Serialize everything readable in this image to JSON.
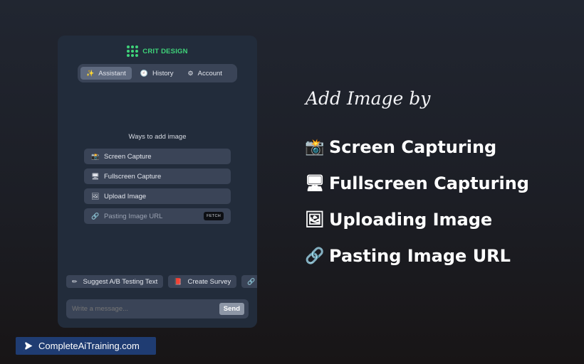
{
  "brand": {
    "name": "CRIT DESIGN",
    "color": "#3fd47a"
  },
  "tabs": [
    {
      "icon": "sparkles-icon",
      "glyph": "✨",
      "label": "Assistant",
      "active": true
    },
    {
      "icon": "clock-icon",
      "glyph": "🕘",
      "label": "History",
      "active": false
    },
    {
      "icon": "gear-icon",
      "glyph": "⚙",
      "label": "Account",
      "active": false
    }
  ],
  "ways": {
    "title": "Ways to add image",
    "options": [
      {
        "icon": "camera-flash-icon",
        "glyph": "📸",
        "label": "Screen Capture"
      },
      {
        "icon": "desktop-computer-icon",
        "glyph": "🖥",
        "label": "Fullscreen Capture"
      },
      {
        "icon": "framed-picture-icon",
        "glyph": "🖼",
        "label": "Upload Image"
      }
    ],
    "url": {
      "icon": "link-icon",
      "glyph": "🔗",
      "placeholder": "Pasting Image URL",
      "fetch_label": "FETCH"
    }
  },
  "suggestions": [
    {
      "icon": "pencil-icon",
      "glyph": "✏",
      "label": "Suggest A/B Testing Text"
    },
    {
      "icon": "clipboard-icon",
      "glyph": "📕",
      "label": "Create Survey"
    },
    {
      "icon": "link-icon",
      "glyph": "🔗",
      "label": ""
    }
  ],
  "composer": {
    "placeholder": "Write a message...",
    "send_label": "Send"
  },
  "promo": {
    "heading": "Add Image by",
    "features": [
      {
        "icon": "camera-flash-icon",
        "glyph": "📸",
        "label": "Screen Capturing"
      },
      {
        "icon": "desktop-computer-icon",
        "glyph": "🖥",
        "label": "Fullscreen Capturing"
      },
      {
        "icon": "framed-picture-icon",
        "glyph": "🖼",
        "label": "Uploading Image"
      },
      {
        "icon": "link-icon",
        "glyph": "🔗",
        "label": "Pasting Image URL"
      }
    ]
  },
  "watermark": {
    "text": "CompleteAiTraining.com",
    "background": "#1f3c72"
  }
}
